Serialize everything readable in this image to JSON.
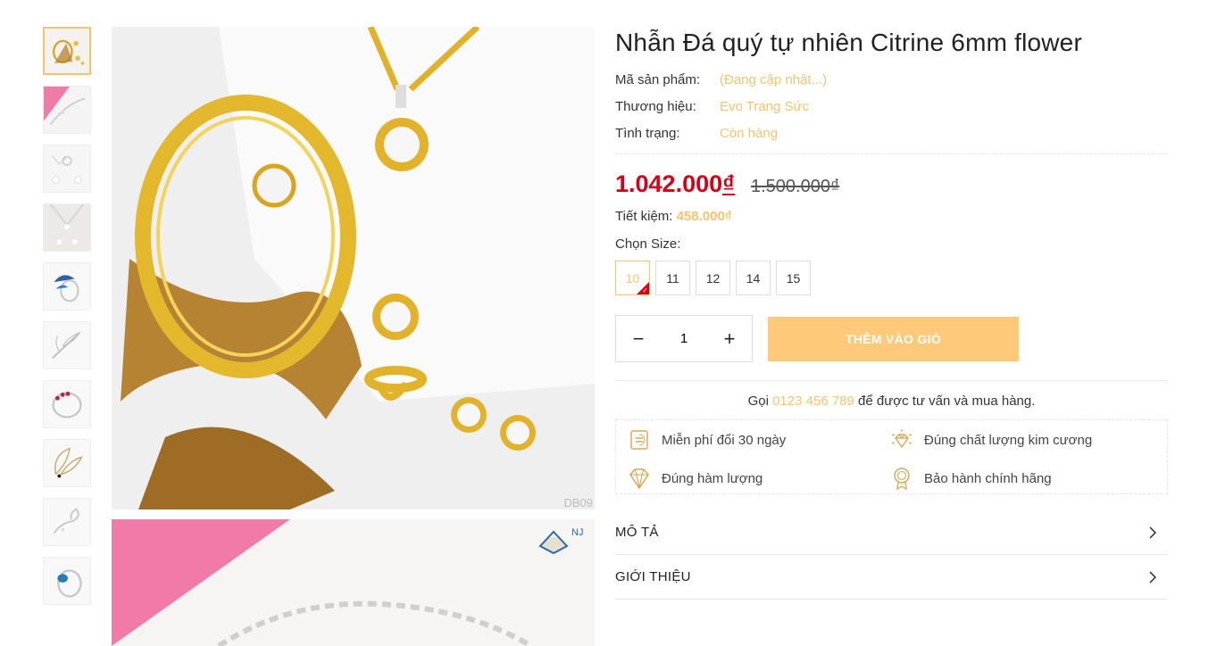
{
  "product": {
    "title": "Nhẫn Đá quý tự nhiên Citrine 6mm flower",
    "sku_label": "Mã sản phẩm:",
    "sku_value": "(Đang cập nhật...)",
    "brand_label": "Thương hiệu:",
    "brand_value": "Evo Trang Sức",
    "status_label": "Tình trạng:",
    "status_value": "Còn hàng",
    "price_number": "1.042.000",
    "price_currency": "₫",
    "old_price": "1.500.000₫",
    "save_label": "Tiết kiệm:",
    "save_value": "458.000₫",
    "size_label": "Chọn Size:",
    "sizes": [
      "10",
      "11",
      "12",
      "14",
      "15"
    ],
    "selected_size": "10",
    "quantity": "1",
    "qty_minus": "−",
    "qty_plus": "+",
    "add_to_cart": "THÊM VÀO GIỎ"
  },
  "gallery": {
    "main_code": "DB09",
    "thumb_count": 10
  },
  "contact": {
    "prefix": "Gọi",
    "phone": "0123 456 789",
    "suffix": "để được tư vấn và mua hàng."
  },
  "benefits": [
    {
      "icon": "exchange-box-icon",
      "text": "Miễn phí đổi 30 ngày"
    },
    {
      "icon": "diamond-rays-icon",
      "text": "Đúng chất lượng kim cương"
    },
    {
      "icon": "diamond-icon",
      "text": "Đúng hàm lượng"
    },
    {
      "icon": "warranty-badge-icon",
      "text": "Bảo hành chính hãng"
    }
  ],
  "accordion": [
    {
      "label": "MÔ TẢ"
    },
    {
      "label": "GIỚI THIỆU"
    }
  ],
  "colors": {
    "accent": "#f5c36e",
    "button": "#fec978",
    "price": "#d70018"
  }
}
